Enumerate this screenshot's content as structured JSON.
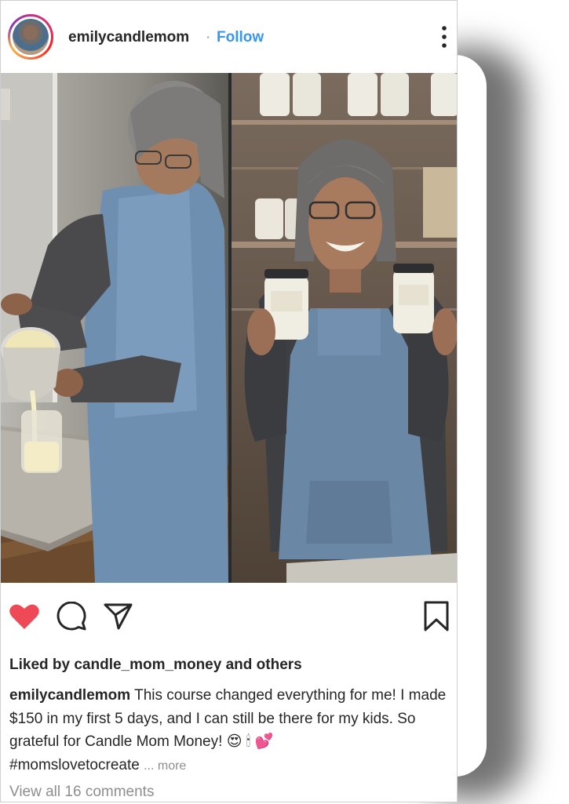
{
  "post": {
    "username": "emilycandlemom",
    "separator": "·",
    "follow_label": "Follow",
    "more_options_icon": "more-vertical-icon",
    "liked": true,
    "accent_color": "#3897f0",
    "like_color": "#ed4956"
  },
  "actions": {
    "like_icon": "heart-icon",
    "comment_icon": "comment-icon",
    "share_icon": "send-icon",
    "save_icon": "bookmark-icon"
  },
  "likes": {
    "prefix": "Liked by ",
    "user": "candle_mom_money",
    "suffix": " and others"
  },
  "caption": {
    "user": "emilycandlemom",
    "text": "This course changed everything for me! I made $150 in my first 5 days, and I can still be there for my kids. So grateful for Candle Mom Money!",
    "emojis": "😍 🕯 💕",
    "hashtag": "#momslovetocreate",
    "more": "... more"
  },
  "comments": {
    "label": "View all 16 comments"
  }
}
